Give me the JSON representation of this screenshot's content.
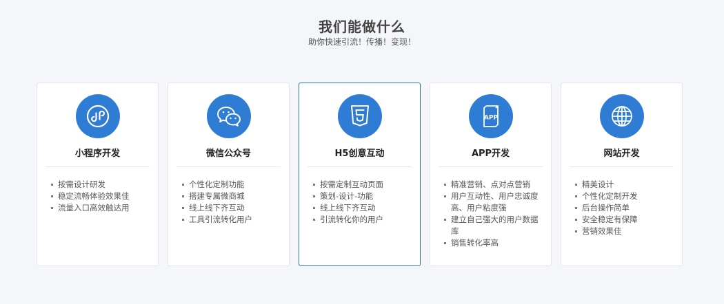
{
  "header": {
    "title": "我们能做什么",
    "subtitle": "助你快速引流！传播！变现！"
  },
  "cards": [
    {
      "title": "小程序开发",
      "icon": "mini-program-icon",
      "features": [
        "按需设计研发",
        "稳定流畅体验效果佳",
        "流量入口高效触达用"
      ]
    },
    {
      "title": "微信公众号",
      "icon": "wechat-icon",
      "features": [
        "个性化定制功能",
        "搭建专属微商城",
        "线上线下齐互动",
        "工具引流转化用户"
      ]
    },
    {
      "title": "H5创意互动",
      "icon": "html5-icon",
      "features": [
        "按需定制互动页面",
        "策划-设计-功能",
        "线上线下齐互动",
        "引流转化你的用户"
      ]
    },
    {
      "title": "APP开发",
      "icon": "app-icon",
      "features": [
        "精准营销、点对点营销",
        "用户互动性、用户忠诚度高、用户粘度强",
        "建立自己强大的用户数据库",
        "销售转化率高"
      ]
    },
    {
      "title": "网站开发",
      "icon": "globe-icon",
      "features": [
        "精美设计",
        "个性化定制开发",
        "后台操作简单",
        "安全稳定有保障",
        "营销效果佳"
      ]
    }
  ],
  "colors": {
    "accent": "#2e7cd4",
    "active_border": "#2a6fb8",
    "background": "#f4f6f9"
  }
}
